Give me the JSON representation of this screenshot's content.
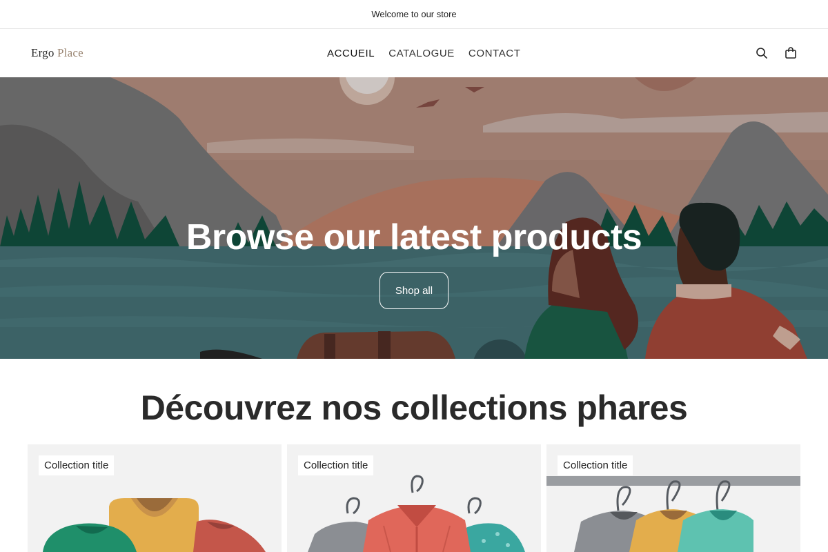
{
  "announcement": "Welcome to our store",
  "header": {
    "logo_part1": "Ergo",
    "logo_part2": "Place",
    "nav": [
      "ACCUEIL",
      "CATALOGUE",
      "CONTACT"
    ],
    "icons": [
      "search-icon",
      "bag-icon"
    ]
  },
  "hero": {
    "title": "Browse our latest products",
    "button": "Shop all"
  },
  "collections": {
    "title": "Découvrez nos collections phares",
    "cards": [
      {
        "label": "Collection title"
      },
      {
        "label": "Collection title"
      },
      {
        "label": "Collection title"
      }
    ]
  },
  "colors": {
    "hero_sky": "#a07c6e",
    "hero_water": "#3f6a6e",
    "card_bg": "#f2f2f2",
    "text_dark": "#2a2a2a"
  }
}
